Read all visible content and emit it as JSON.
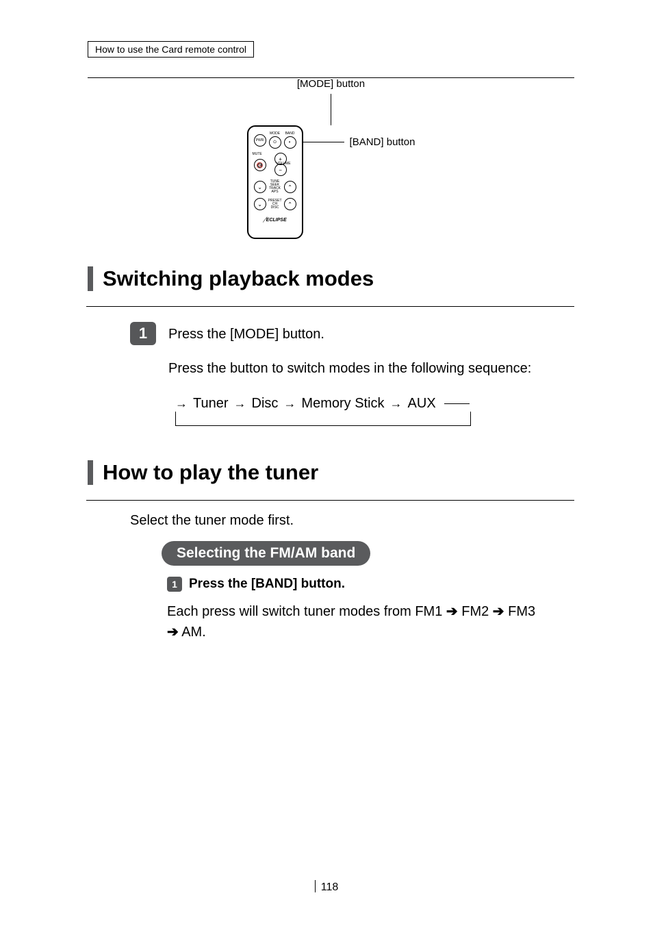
{
  "header": {
    "title": "How to use the Card remote control"
  },
  "diagram": {
    "mode_label": "[MODE] button",
    "band_label": "[BAND] button",
    "remote": {
      "pwr": "PWR",
      "mode_tiny": "MODE",
      "band_tiny": "BAND",
      "mute": "MUTE",
      "volume": "VOLUME",
      "tune_seek": "TUNE SEEK",
      "track_aps": "TRACK APS",
      "preset_ch": "PRESET CH",
      "disc": "DISC",
      "brand": "ECLIPSE"
    }
  },
  "section1": {
    "heading": "Switching playback modes",
    "step1_num": "1",
    "step1_text": "Press the [MODE] button.",
    "step1_detail": "Press the button to switch modes in the following sequence:",
    "cycle": {
      "a": "Tuner",
      "b": "Disc",
      "c": "Memory Stick",
      "d": "AUX"
    }
  },
  "section2": {
    "heading": "How to play the tuner",
    "intro": "Select the tuner mode first.",
    "pill": "Selecting the FM/AM band",
    "sub1_num": "1",
    "sub1_text": "Press the [BAND] button.",
    "sub1_detail_pre": "Each press will switch tuner modes from FM1 ",
    "sub1_detail_mid1": " FM2 ",
    "sub1_detail_mid2": " FM3 ",
    "sub1_detail_end": " AM.",
    "arrow": "➔"
  },
  "page_number": "118"
}
